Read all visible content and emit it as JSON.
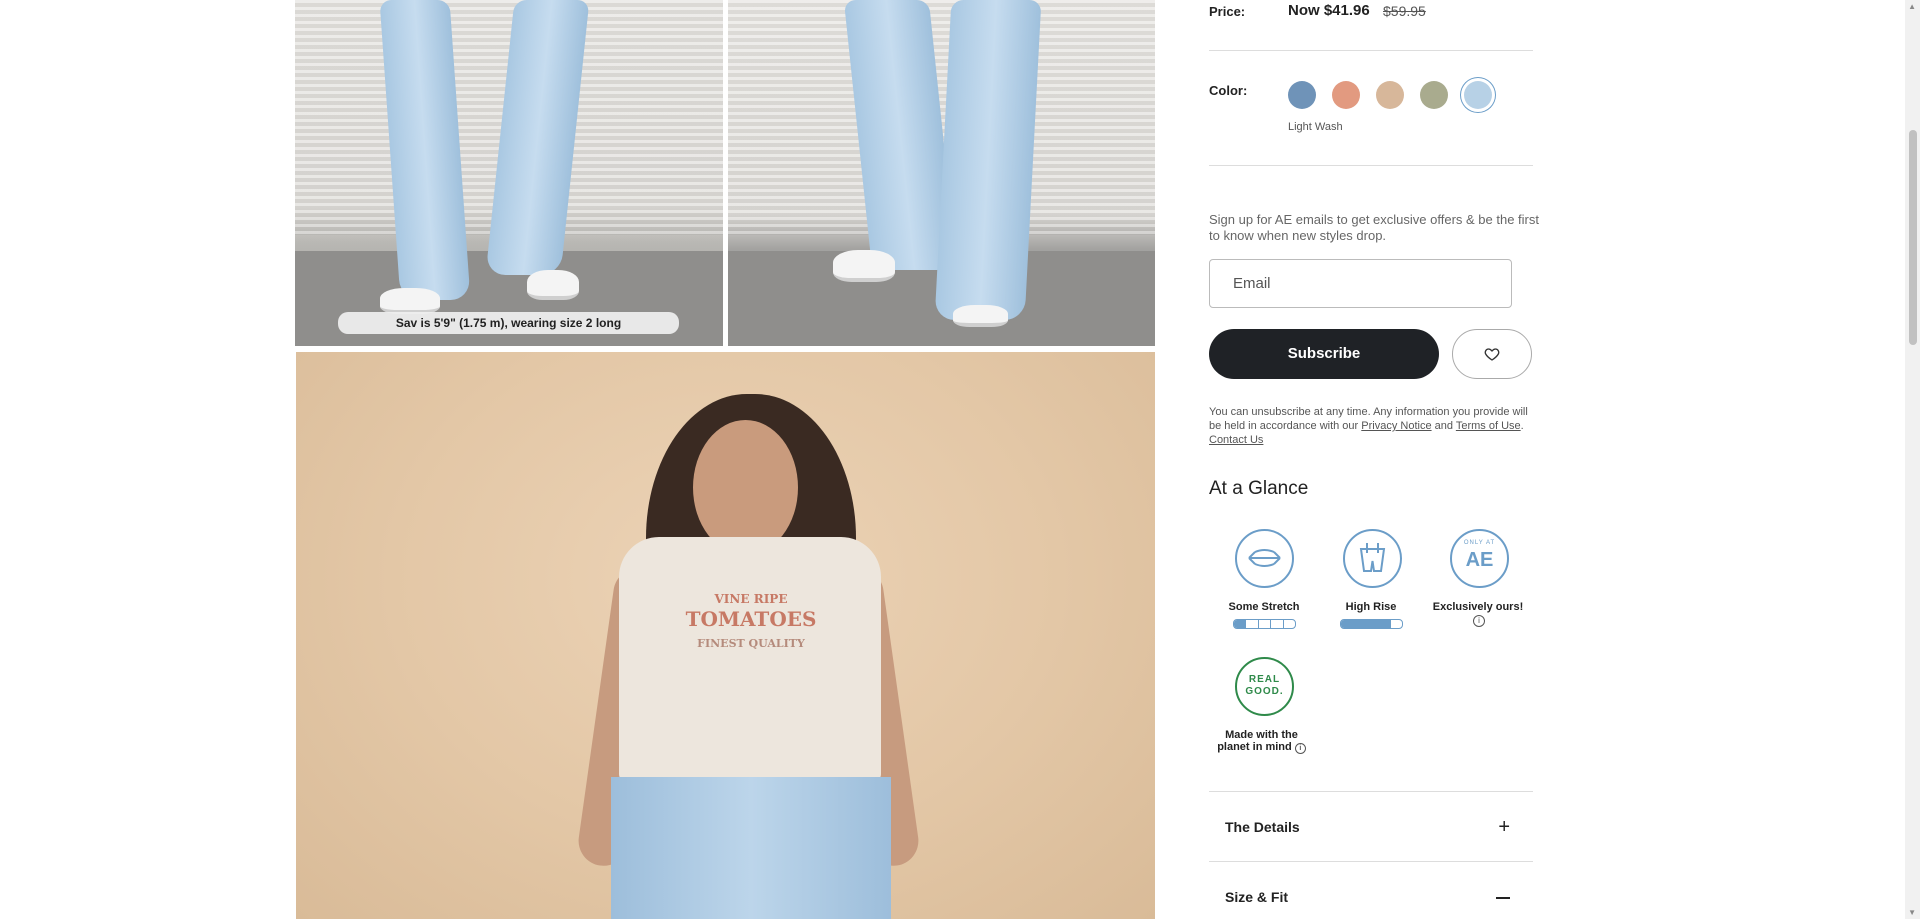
{
  "photos": {
    "caption": "Sav is 5'9\" (1.75 m), wearing size 2 long",
    "tee_line1": "VINE RIPE",
    "tee_line2": "TOMATOES",
    "tee_line3": "FINEST QUALITY"
  },
  "price": {
    "label": "Price:",
    "now": "Now $41.96",
    "was": "$59.95"
  },
  "color": {
    "label": "Color:",
    "selected_name": "Light Wash",
    "swatches": [
      "#6f93b8",
      "#e29a80",
      "#d7b79a",
      "#a9ab8e",
      "#b7d1e6"
    ],
    "selected_index": 4
  },
  "signup": {
    "text": "Sign up for AE emails to get exclusive offers & be the first to know when new styles drop.",
    "email_placeholder": "Email",
    "subscribe_label": "Subscribe",
    "legal_prefix": "You can unsubscribe at any time. Any information you provide will be held in accordance with our",
    "privacy_link": "Privacy Notice",
    "and_text": "and",
    "terms_link": "Terms of Use",
    "contact_link": "Contact Us"
  },
  "glance": {
    "title": "At a Glance",
    "stretch_label": "Some Stretch",
    "stretch_level": 1,
    "rise_label": "High Rise",
    "rise_level": 4,
    "exclusive_label": "Exclusively ours!",
    "exclusive_badge_top": "ONLY AT",
    "exclusive_badge_main": "AE",
    "planet_label_1": "Made with the",
    "planet_label_2": "planet in mind",
    "planet_badge_1": "REAL",
    "planet_badge_2": "GOOD."
  },
  "accordions": {
    "details": "The Details",
    "size_fit": "Size & Fit"
  }
}
